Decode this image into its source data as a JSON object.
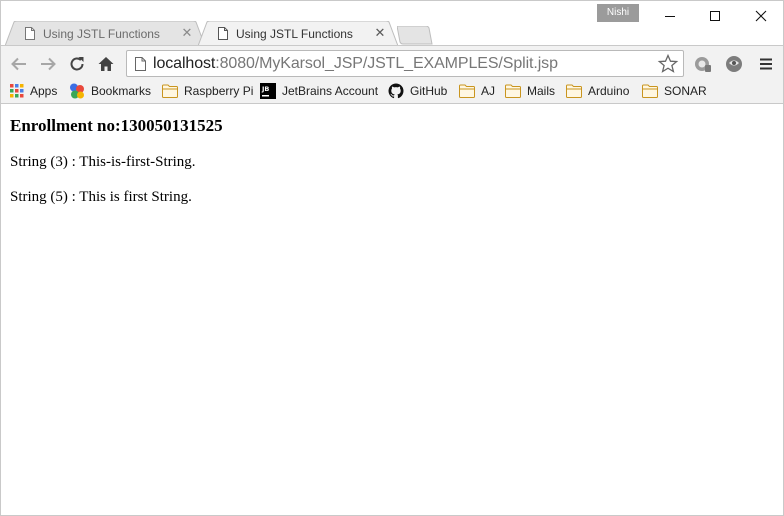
{
  "tabs": [
    {
      "title": "Using JSTL Functions",
      "active": false
    },
    {
      "title": "Using JSTL Functions",
      "active": true
    }
  ],
  "profile": {
    "name": "Nishi"
  },
  "address_bar": {
    "host": "localhost",
    "path": ":8080/MyKarsol_JSP/JSTL_EXAMPLES/Split.jsp"
  },
  "bookmarks": [
    {
      "label": "Apps",
      "icon": "apps-grid-icon"
    },
    {
      "label": "Bookmarks",
      "icon": "google-bookmarks-icon"
    },
    {
      "label": "Raspberry Pi",
      "icon": "folder-icon"
    },
    {
      "label": "JetBrains Account",
      "icon": "jetbrains-icon"
    },
    {
      "label": "GitHub",
      "icon": "github-icon"
    },
    {
      "label": "AJ",
      "icon": "folder-icon"
    },
    {
      "label": "Mails",
      "icon": "folder-icon"
    },
    {
      "label": "Arduino",
      "icon": "folder-icon"
    },
    {
      "label": "SONAR",
      "icon": "folder-icon"
    }
  ],
  "page": {
    "heading": "Enrollment no:130050131525",
    "lines": [
      "String (3) : This-is-first-String.",
      "String (5) : This is first String."
    ]
  },
  "colors": {
    "chrome_bg": "#f2f2f2",
    "border": "#c9c9c9",
    "folder": "#e8b53c",
    "profile_badge": "#9b9b9b"
  }
}
